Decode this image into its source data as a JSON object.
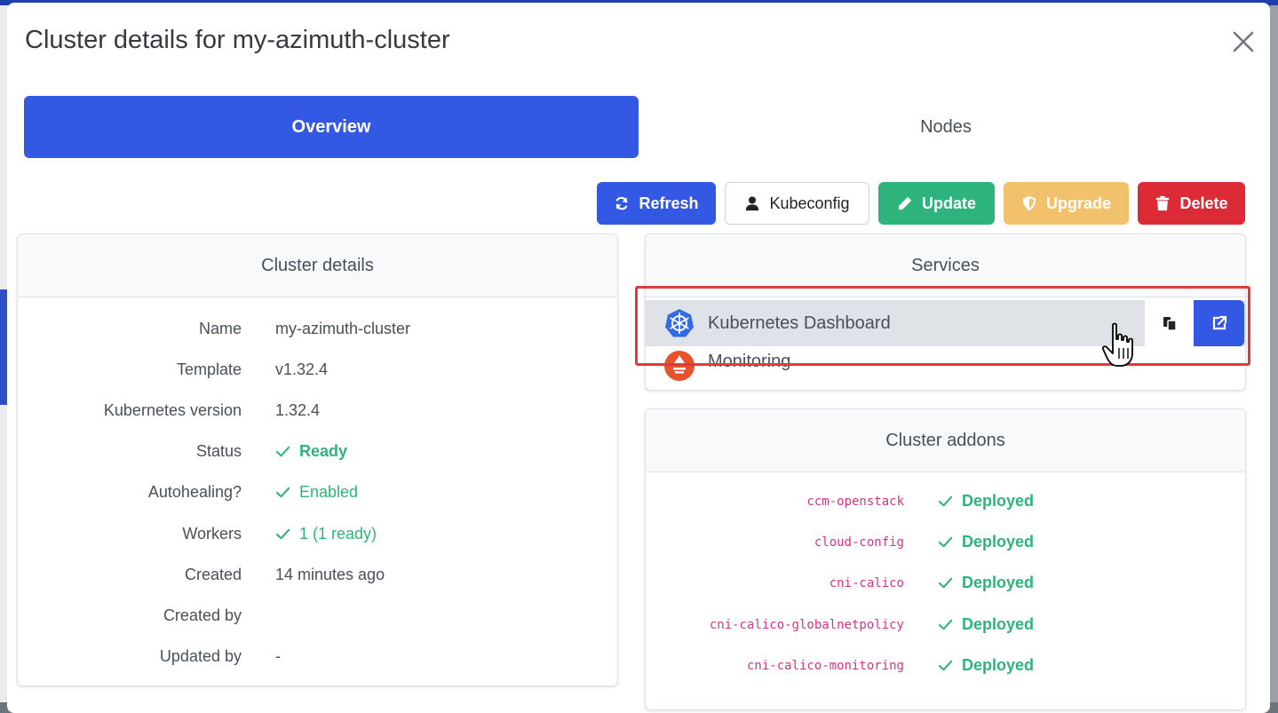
{
  "modal": {
    "title": "Cluster details for my-azimuth-cluster"
  },
  "tabs": [
    {
      "label": "Overview",
      "active": true
    },
    {
      "label": "Nodes",
      "active": false
    }
  ],
  "toolbar": {
    "refresh": "Refresh",
    "kubeconfig": "Kubeconfig",
    "update": "Update",
    "upgrade": "Upgrade",
    "delete": "Delete"
  },
  "details": {
    "header": "Cluster details",
    "rows": [
      {
        "label": "Name",
        "value": "my-azimuth-cluster"
      },
      {
        "label": "Template",
        "value": "v1.32.4"
      },
      {
        "label": "Kubernetes version",
        "value": "1.32.4"
      },
      {
        "label": "Status",
        "value": "Ready"
      },
      {
        "label": "Autohealing?",
        "value": "Enabled"
      },
      {
        "label": "Workers",
        "value": "1 (1 ready)"
      },
      {
        "label": "Created",
        "value": "14 minutes ago"
      },
      {
        "label": "Created by",
        "value": ""
      },
      {
        "label": "Updated by",
        "value": "-"
      }
    ]
  },
  "services": {
    "header": "Services",
    "items": [
      {
        "label": "Kubernetes Dashboard",
        "icon": "kubernetes-icon"
      },
      {
        "label": "Monitoring",
        "icon": "prometheus-icon"
      }
    ]
  },
  "addons": {
    "header": "Cluster addons",
    "items": [
      {
        "name": "ccm-openstack",
        "status": "Deployed"
      },
      {
        "name": "cloud-config",
        "status": "Deployed"
      },
      {
        "name": "cni-calico",
        "status": "Deployed"
      },
      {
        "name": "cni-calico-globalnetpolicy",
        "status": "Deployed"
      },
      {
        "name": "cni-calico-monitoring",
        "status": "Deployed"
      }
    ]
  },
  "colors": {
    "primary": "#3358e4",
    "success": "#2fb37d",
    "warning": "#f2c16c",
    "danger": "#dc2b36",
    "highlight": "#e03b3b"
  }
}
